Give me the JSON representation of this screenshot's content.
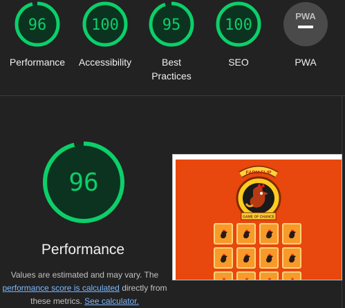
{
  "summary": {
    "gauges": [
      {
        "score": "96",
        "label_lines": [
          "Performance"
        ]
      },
      {
        "score": "100",
        "label_lines": [
          "Accessibility"
        ]
      },
      {
        "score": "95",
        "label_lines": [
          "Best",
          "Practices"
        ]
      },
      {
        "score": "100",
        "label_lines": [
          "SEO"
        ]
      },
      {
        "score": "PWA",
        "label_lines": [
          "PWA"
        ]
      }
    ]
  },
  "performance": {
    "score": "96",
    "title": "Performance",
    "note_text_1": "Values are estimated and may vary. The",
    "note_link_1": "performance score is calculated",
    "note_text_2": " directly from",
    "note_text_3": "these metrics. ",
    "note_link_2": "See calculator."
  },
  "screenshot": {
    "logo_title": "FARM FLIP",
    "logo_subtitle": "GAME OF CHANCE"
  },
  "colors": {
    "pass_green": "#0ccf6a",
    "pass_bg": "#0c3320",
    "link_blue": "#7cb9ff",
    "game_orange": "#e8470d"
  },
  "icons": [
    "pwa-na-icon",
    "rooster-icon"
  ]
}
